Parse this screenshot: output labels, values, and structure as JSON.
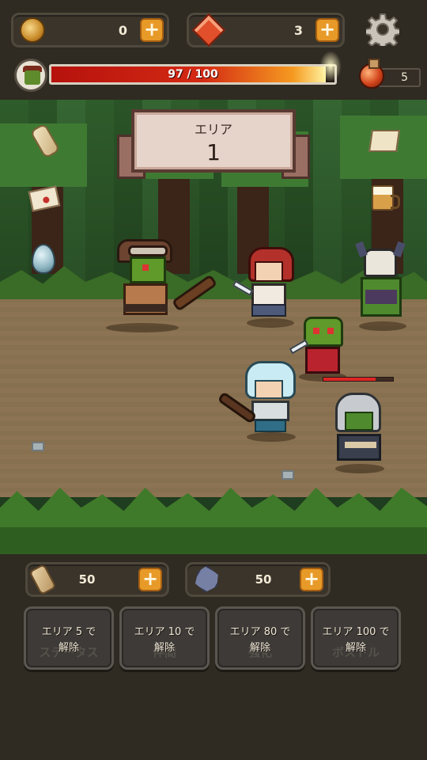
{
  "hud": {
    "coins": "0",
    "gems": "3",
    "hp_text": "97 / 100",
    "hp_fraction": 0.97,
    "potions": "5"
  },
  "area": {
    "label": "エリア",
    "number": "1"
  },
  "battle": {
    "enemy_hp_fraction": 0.75
  },
  "bottom": {
    "scrolls": "50",
    "ore": "50",
    "locked_buttons": [
      {
        "line1": "エリア 5 で",
        "line2": "解除",
        "ghost": "ステータス"
      },
      {
        "line1": "エリア 10 で",
        "line2": "解除",
        "ghost": "仲間"
      },
      {
        "line1": "エリア 80 で",
        "line2": "解除",
        "ghost": "強化"
      },
      {
        "line1": "エリア 100 で",
        "line2": "解除",
        "ghost": "ボストル"
      }
    ]
  },
  "colors": {
    "hp_bar": "#d42a14",
    "plus_button": "#e89a28",
    "panel_bg": "#2f2a22"
  },
  "icons": [
    "coin-icon",
    "gem-icon",
    "gear-icon",
    "avatar",
    "potion-icon",
    "scroll-icon",
    "letter-icon",
    "egg-icon",
    "map-icon",
    "mug-icon",
    "ore-icon"
  ]
}
